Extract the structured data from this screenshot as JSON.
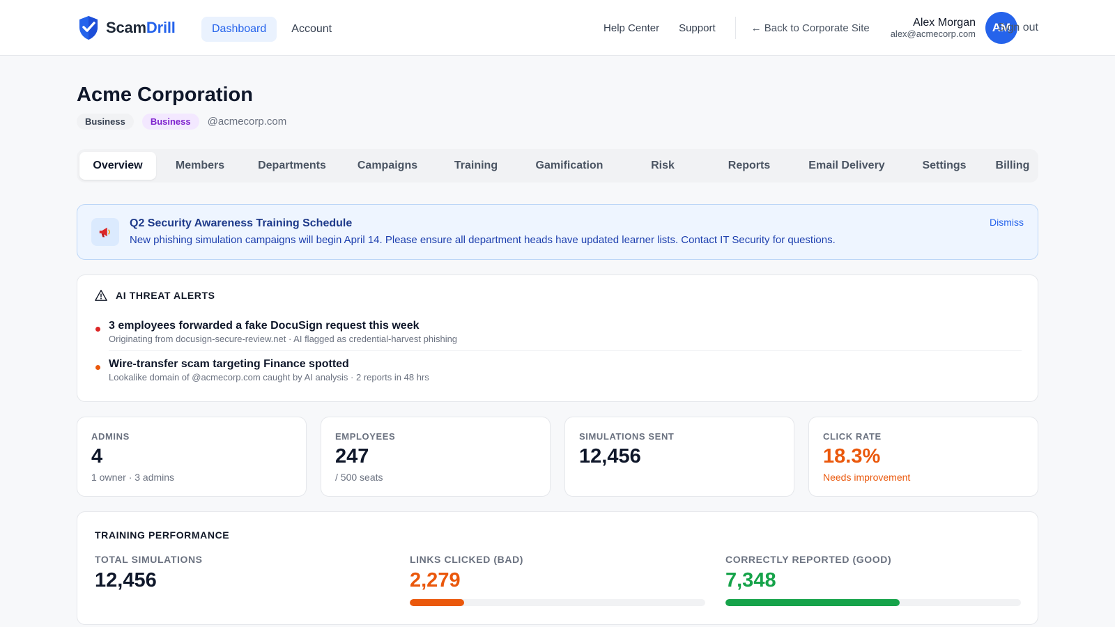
{
  "header": {
    "brand_first": "Scam",
    "brand_second": "Drill",
    "nav": [
      {
        "label": "Dashboard",
        "active": true
      },
      {
        "label": "Account",
        "active": false
      }
    ],
    "help_center": "Help Center",
    "support": "Support",
    "back_link": "← Back to Corporate Site",
    "user_name": "Alex Morgan",
    "user_email": "alex@acmecorp.com",
    "avatar_initials": "AM",
    "sign_out": "Sign out"
  },
  "org": {
    "name": "Acme Corporation",
    "badges": [
      "Business",
      "Business"
    ],
    "domain": "@acmecorp.com"
  },
  "tabs": [
    {
      "label": "Overview",
      "active": true
    },
    {
      "label": "Members"
    },
    {
      "label": "Departments"
    },
    {
      "label": "Campaigns"
    },
    {
      "label": "Training"
    },
    {
      "label": "Gamification"
    },
    {
      "label": "Risk"
    },
    {
      "label": "Reports"
    },
    {
      "label": "Email Delivery"
    },
    {
      "label": "Settings"
    },
    {
      "label": "Billing"
    }
  ],
  "announcement": {
    "icon": "megaphone-icon",
    "title": "Q2 Security Awareness Training Schedule",
    "body": "New phishing simulation campaigns will begin April 14. Please ensure all department heads have updated learner lists. Contact IT Security for questions.",
    "dismiss": "Dismiss"
  },
  "threats": {
    "title": "AI THREAT ALERTS",
    "icon": "warning-triangle-icon",
    "items": [
      {
        "title": "3 employees forwarded a fake DocuSign request this week",
        "subtitle": "Originating from docusign-secure-review.net · AI flagged as credential-harvest phishing",
        "severity_color": "#dc2626"
      },
      {
        "title": "Wire-transfer scam targeting Finance spotted",
        "subtitle": "Lookalike domain of @acmecorp.com caught by AI analysis · 2 reports in 48 hrs",
        "severity_color": "#ea580c"
      }
    ]
  },
  "stats": [
    {
      "label": "ADMINS",
      "value": "4",
      "sub": "1 owner · 3 admins",
      "value_color": "#0f172a",
      "sub_color": "#6b7280"
    },
    {
      "label": "EMPLOYEES",
      "value": "247",
      "sub": "/ 500 seats",
      "value_color": "#0f172a",
      "sub_color": "#6b7280"
    },
    {
      "label": "SIMULATIONS SENT",
      "value": "12,456",
      "sub": "",
      "value_color": "#0f172a",
      "sub_color": "#6b7280"
    },
    {
      "label": "CLICK RATE",
      "value": "18.3%",
      "sub": "Needs improvement",
      "value_color": "#ea580c",
      "sub_color": "#ea580c"
    }
  ],
  "training": {
    "title": "TRAINING PERFORMANCE",
    "metrics": [
      {
        "label": "TOTAL SIMULATIONS",
        "value": "12,456",
        "color": "#0f172a"
      },
      {
        "label": "LINKS CLICKED (BAD)",
        "value": "2,279",
        "color": "#ea580c",
        "bar_fraction": 0.183
      },
      {
        "label": "CORRECTLY REPORTED (GOOD)",
        "value": "7,348",
        "color": "#16a34a",
        "bar_fraction": 0.59
      }
    ]
  },
  "colors": {
    "accent": "#2563eb",
    "warning": "#ea580c",
    "success": "#16a34a",
    "danger": "#dc2626"
  }
}
